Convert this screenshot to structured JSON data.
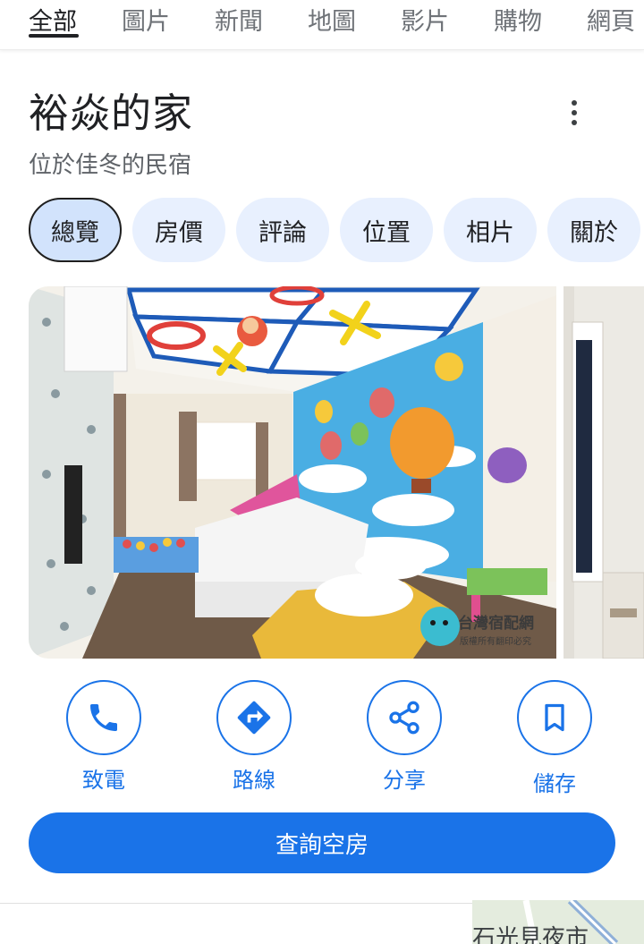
{
  "search_tabs": [
    "全部",
    "圖片",
    "新聞",
    "地圖",
    "影片",
    "購物",
    "網頁"
  ],
  "place": {
    "name": "裕焱的家",
    "subtitle": "位於佳冬的民宿"
  },
  "chips": [
    "總覽",
    "房價",
    "評論",
    "位置",
    "相片",
    "關於"
  ],
  "photo": {
    "watermark_title": "台灣宿配網",
    "watermark_sub": "版權所有翻印必究"
  },
  "actions": {
    "call": "致電",
    "directions": "路線",
    "share": "分享",
    "save": "儲存"
  },
  "availability_button": "查詢空房",
  "map_label": "石光見夜市",
  "colors": {
    "accent": "#1a73e8",
    "chip_bg": "#e8f0fe",
    "chip_active_bg": "#d2e3fc"
  }
}
